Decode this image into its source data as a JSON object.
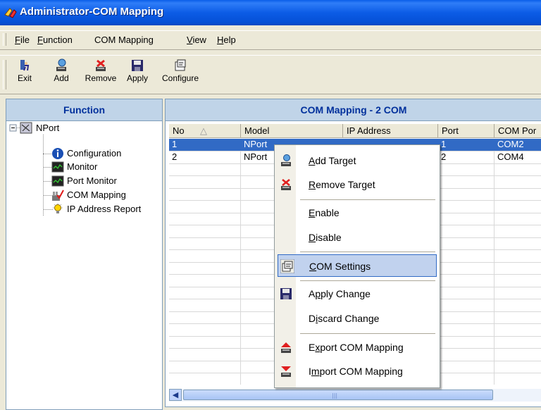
{
  "window": {
    "title": "Administrator-COM Mapping"
  },
  "menubar": {
    "items": [
      {
        "label": "File"
      },
      {
        "label": "Function"
      },
      {
        "label": "COM Mapping"
      },
      {
        "label": "View"
      },
      {
        "label": "Help"
      }
    ]
  },
  "toolbar": {
    "buttons": [
      {
        "label": "Exit",
        "icon": "exit-icon"
      },
      {
        "label": "Add",
        "icon": "add-icon"
      },
      {
        "label": "Remove",
        "icon": "remove-icon"
      },
      {
        "label": "Apply",
        "icon": "save-icon"
      },
      {
        "label": "Configure",
        "icon": "configure-icon"
      }
    ]
  },
  "left_panel": {
    "header": "Function",
    "tree": {
      "root": "NPort",
      "children": [
        "Configuration",
        "Monitor",
        "Port Monitor",
        "COM Mapping",
        "IP Address Report"
      ],
      "selected": "COM Mapping"
    }
  },
  "right_panel": {
    "header": "COM Mapping - 2 COM",
    "columns": [
      "No",
      "Model",
      "IP Address",
      "Port",
      "COM Por"
    ],
    "sort_indicator": "△",
    "rows": [
      {
        "no": "1",
        "model": "NPort",
        "ip": "",
        "port": "1",
        "com": "COM2",
        "selected": true
      },
      {
        "no": "2",
        "model": "NPort",
        "ip": "",
        "port": "2",
        "com": "COM4",
        "selected": false
      }
    ]
  },
  "context_menu": {
    "items": [
      {
        "label": "Add Target",
        "icon": "add-target-icon"
      },
      {
        "label": "Remove Target",
        "icon": "remove-target-icon"
      },
      {
        "label": "Enable",
        "icon": ""
      },
      {
        "label": "Disable",
        "icon": ""
      },
      {
        "label": "COM Settings",
        "icon": "com-settings-icon",
        "highlighted": true
      },
      {
        "label": "Apply Change",
        "icon": "apply-change-icon"
      },
      {
        "label": "Discard Change",
        "icon": ""
      },
      {
        "label": "Export COM Mapping",
        "icon": "export-icon"
      },
      {
        "label": "Import COM Mapping",
        "icon": "import-icon"
      }
    ]
  },
  "colors": {
    "title_blue": "#0c5ce6",
    "header_text": "#00309c",
    "selection": "#316ac5",
    "menu_highlight": "#c1d2ee"
  }
}
